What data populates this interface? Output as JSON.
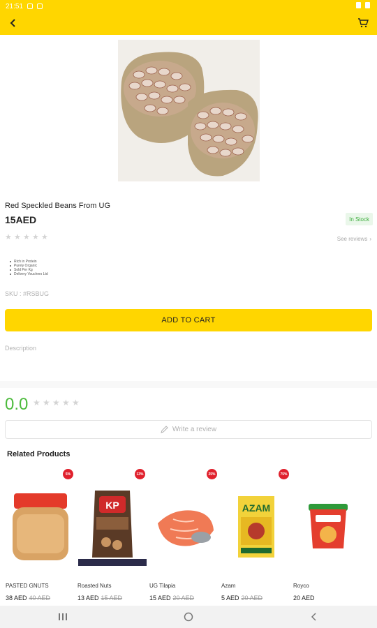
{
  "status_bar": {
    "time": "21:51"
  },
  "product": {
    "name": "Red Speckled Beans From UG",
    "price": "15AED",
    "stock": "In Stock",
    "see_reviews": "See reviews",
    "features": [
      "Rich in Protein",
      "Purely Organic",
      "Sold Per Kg",
      "Delivery Vouchers Ltd"
    ],
    "sku": "SKU : #RSBUG",
    "rating_stars": 0
  },
  "actions": {
    "add_to_cart": "ADD TO CART"
  },
  "description": {
    "label": "Description"
  },
  "reviews": {
    "score": "0.0",
    "write_review": "Write a review"
  },
  "related": {
    "title": "Related Products",
    "items": [
      {
        "name": "PASTED GNUTS",
        "price": "38 AED",
        "old_price": "40 AED",
        "discount": "5%"
      },
      {
        "name": "Roasted Nuts",
        "price": "13 AED",
        "old_price": "15 AED",
        "discount": "13%"
      },
      {
        "name": "UG Tilapia",
        "price": "15 AED",
        "old_price": "20 AED",
        "discount": "25%"
      },
      {
        "name": "Azam",
        "price": "5 AED",
        "old_price": "20 AED",
        "discount": "75%"
      },
      {
        "name": "Royco",
        "price": "20 AED",
        "old_price": "",
        "discount": ""
      }
    ]
  },
  "colors": {
    "brand": "#ffd600",
    "rating_green": "#4cbb3c",
    "discount_red": "#e0212d"
  },
  "icons": {
    "back": "arrow-left-icon",
    "cart": "shopping-cart-icon",
    "pencil": "pencil-icon"
  }
}
